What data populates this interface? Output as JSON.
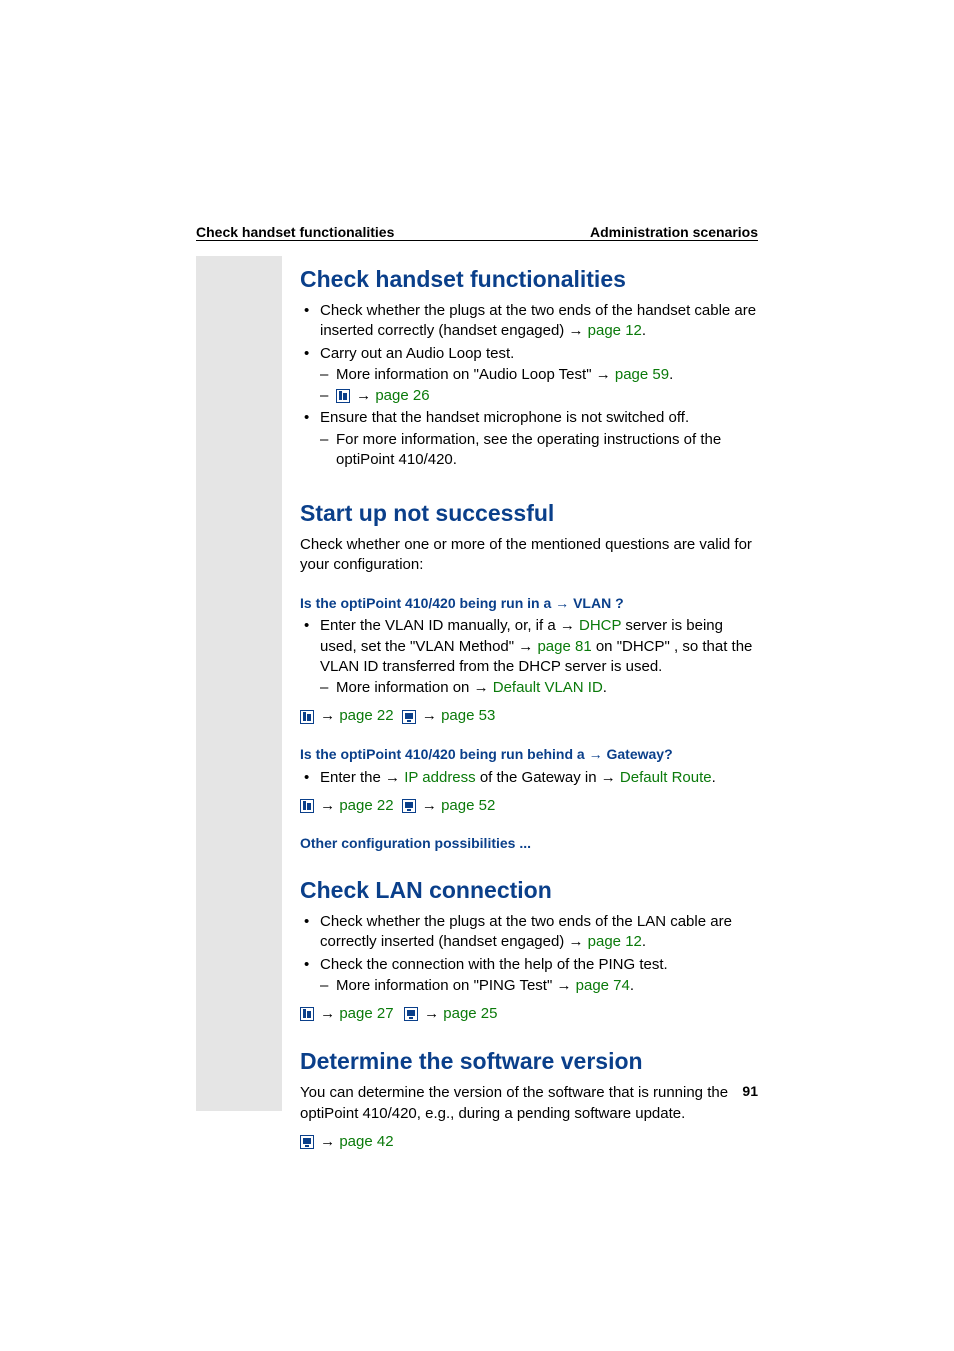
{
  "header": {
    "left": "Check handset functionalities",
    "right": "Administration scenarios"
  },
  "page_number": "91",
  "sections": {
    "s1": {
      "title": "Check handset functionalities",
      "b1": "Check whether the plugs at the two ends of the handset cable are inserted correctly (handset engaged) ",
      "b1_link": "page 12",
      "b2": "Carry out an Audio Loop test.",
      "b2_d1_a": "More information on \"Audio Loop Test\" ",
      "b2_d1_link": "page 59",
      "b2_d2_link": "page 26",
      "b3": "Ensure that the handset microphone is not switched off.",
      "b3_d1": "For more information, see the operating instructions of the optiPoint 410/420."
    },
    "s2": {
      "title": "Start up not successful",
      "intro": "Check whether one or more of the mentioned questions are valid for your configuration:",
      "q1_a": "Is the optiPoint 410/420 being run in a ",
      "q1_link": "VLAN",
      "q1_b": " ?",
      "q1_b1_a": "Enter the VLAN ID manually, or, if a ",
      "q1_b1_link1": "DHCP",
      "q1_b1_b": " server is being used, set the \"VLAN Method\" ",
      "q1_b1_link2": "page 81",
      "q1_b1_c": " on \"DHCP\" , so that the VLAN ID transferred from the DHCP server is used.",
      "q1_b1_d1_a": "More information on ",
      "q1_b1_d1_link": "Default VLAN ID",
      "q1_icons_p1": "page 22",
      "q1_icons_p2": "page 53",
      "q2_a": "Is the optiPoint 410/420 being run behind a ",
      "q2_link": "Gateway",
      "q2_b": "?",
      "q2_b1_a": "Enter the ",
      "q2_b1_link1": "IP address",
      "q2_b1_b": " of the Gateway in ",
      "q2_b1_link2": "Default Route",
      "q2_icons_p1": "page 22",
      "q2_icons_p2": "page 52",
      "q3": "Other configuration possibilities ..."
    },
    "s3": {
      "title": "Check LAN connection",
      "b1_a": "Check whether the plugs at the two ends of the LAN cable are correctly inserted (handset engaged) ",
      "b1_link": "page 12",
      "b2": "Check the connection with the help of the PING test.",
      "b2_d1_a": "More information on \"PING Test\" ",
      "b2_d1_link": "page 74",
      "icons_p1": "page 27",
      "icons_p2": "page 25"
    },
    "s4": {
      "title": "Determine the software version",
      "p1": "You can determine the version of the software that is running the optiPoint 410/420, e.g., during a pending software update.",
      "icons_p1": "page 42"
    }
  }
}
